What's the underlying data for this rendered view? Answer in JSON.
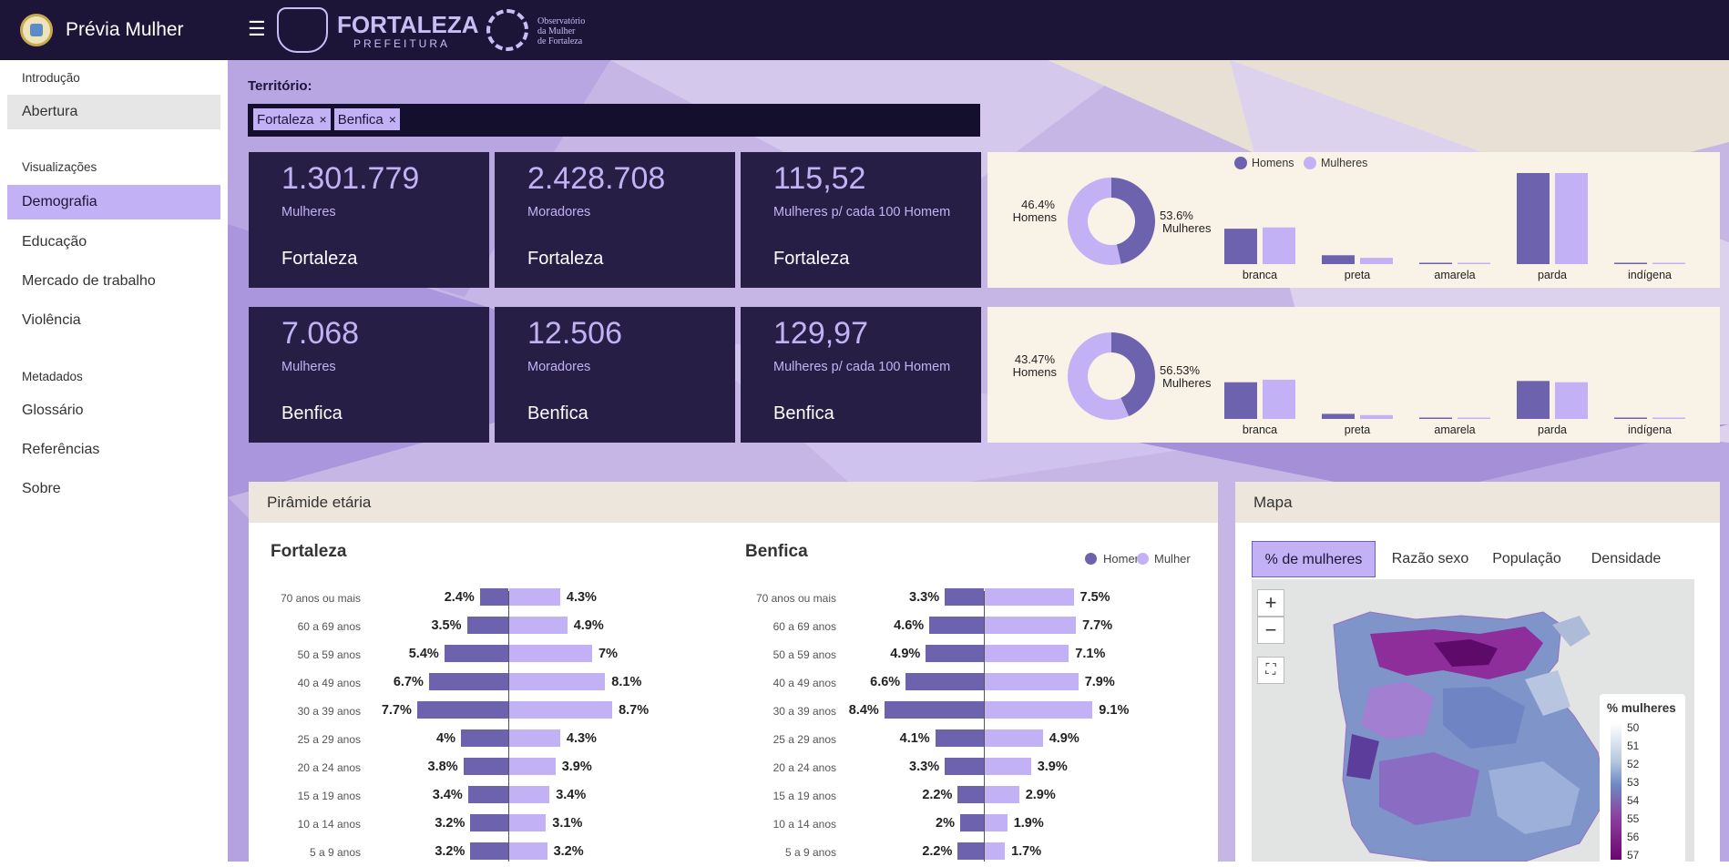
{
  "app": {
    "title": "Prévia Mulher"
  },
  "header": {
    "menu_icon": "hamburger-icon",
    "prefeitura_name": "FORTALEZA",
    "prefeitura_sub": "PREFEITURA",
    "observatorio_lines": [
      "Observatório",
      "da Mulher",
      "de Fortaleza"
    ]
  },
  "sidebar": {
    "sections": [
      {
        "title": "Introdução",
        "items": [
          {
            "label": "Abertura"
          }
        ]
      },
      {
        "title": "Visualizações",
        "items": [
          {
            "label": "Demografia"
          },
          {
            "label": "Educação"
          },
          {
            "label": "Mercado de trabalho"
          },
          {
            "label": "Violência"
          }
        ]
      },
      {
        "title": "Metadados",
        "items": [
          {
            "label": "Glossário"
          },
          {
            "label": "Referências"
          },
          {
            "label": "Sobre"
          }
        ]
      }
    ],
    "active": "Demografia"
  },
  "territorio": {
    "label": "Território:",
    "chips": [
      "Fortaleza",
      "Benfica"
    ],
    "remove_symbol": "×"
  },
  "stats": [
    [
      {
        "value": "1.301.779",
        "label": "Mulheres",
        "place": "Fortaleza"
      },
      {
        "value": "2.428.708",
        "label": "Moradores",
        "place": "Fortaleza"
      },
      {
        "value": "115,52",
        "label": "Mulheres p/ cada 100 Homem",
        "place": "Fortaleza"
      }
    ],
    [
      {
        "value": "7.068",
        "label": "Mulheres",
        "place": "Benfica"
      },
      {
        "value": "12.506",
        "label": "Moradores",
        "place": "Benfica"
      },
      {
        "value": "129,97",
        "label": "Mulheres p/ cada 100 Homem",
        "place": "Benfica"
      }
    ]
  ],
  "colors": {
    "homens": "#6c62ad",
    "mulheres": "#c2b2f5",
    "dark": "#1c1538",
    "card": "#261e45"
  },
  "chart_data": [
    {
      "type": "pie",
      "title": "",
      "labels": [
        "Homens",
        "Mulheres"
      ],
      "values": [
        46.4,
        53.6
      ],
      "value_labels": [
        "46.4%",
        "53.6%"
      ]
    },
    {
      "type": "bar",
      "title": "",
      "legend": [
        "Homens",
        "Mulheres"
      ],
      "legend_position": "top",
      "categories": [
        "branca",
        "preta",
        "amarela",
        "parda",
        "indígena"
      ],
      "series": [
        {
          "name": "Homens",
          "values": [
            28,
            7,
            0.3,
            72,
            0.2
          ]
        },
        {
          "name": "Mulheres",
          "values": [
            29,
            5,
            0.3,
            72,
            0.2
          ]
        }
      ]
    },
    {
      "type": "pie",
      "title": "",
      "labels": [
        "Homens",
        "Mulheres"
      ],
      "values": [
        43.47,
        56.53
      ],
      "value_labels": [
        "43.47%",
        "56.53%"
      ]
    },
    {
      "type": "bar",
      "title": "",
      "categories": [
        "branca",
        "preta",
        "amarela",
        "parda",
        "indígena"
      ],
      "series": [
        {
          "name": "Homens",
          "values": [
            29,
            4,
            0.5,
            30,
            0.2
          ]
        },
        {
          "name": "Mulheres",
          "values": [
            31,
            3,
            0.5,
            29,
            0.2
          ]
        }
      ]
    },
    {
      "type": "bar",
      "title": "Fortaleza",
      "orientation": "horizontal-pyramid",
      "categories": [
        "70 anos ou mais",
        "60 a 69 anos",
        "50 a 59 anos",
        "40 a 49 anos",
        "30 a 39 anos",
        "25 a 29 anos",
        "20 a 24 anos",
        "15 a 19 anos",
        "10 a 14 anos",
        "5 a 9 anos"
      ],
      "series": [
        {
          "name": "Homem",
          "values": [
            2.4,
            3.5,
            5.4,
            6.7,
            7.7,
            4,
            3.8,
            3.4,
            3.2,
            3.2
          ],
          "labels": [
            "2.4%",
            "3.5%",
            "5.4%",
            "6.7%",
            "7.7%",
            "4%",
            "3.8%",
            "3.4%",
            "3.2%",
            "3.2%"
          ]
        },
        {
          "name": "Mulher",
          "values": [
            4.3,
            4.9,
            7,
            8.1,
            8.7,
            4.3,
            3.9,
            3.4,
            3.1,
            3.2
          ],
          "labels": [
            "4.3%",
            "4.9%",
            "7%",
            "8.1%",
            "8.7%",
            "4.3%",
            "3.9%",
            "3.4%",
            "3.1%",
            "3.2%"
          ]
        }
      ]
    },
    {
      "type": "bar",
      "title": "Benfica",
      "orientation": "horizontal-pyramid",
      "legend": [
        "Homem",
        "Mulher"
      ],
      "legend_position": "top-right",
      "categories": [
        "70 anos ou mais",
        "60 a 69 anos",
        "50 a 59 anos",
        "40 a 49 anos",
        "30 a 39 anos",
        "25 a 29 anos",
        "20 a 24 anos",
        "15 a 19 anos",
        "10 a 14 anos",
        "5 a 9 anos"
      ],
      "series": [
        {
          "name": "Homem",
          "values": [
            3.3,
            4.6,
            4.9,
            6.6,
            8.4,
            4.1,
            3.3,
            2.2,
            2,
            2.2
          ],
          "labels": [
            "3.3%",
            "4.6%",
            "4.9%",
            "6.6%",
            "8.4%",
            "4.1%",
            "3.3%",
            "2.2%",
            "2%",
            "2.2%"
          ]
        },
        {
          "name": "Mulher",
          "values": [
            7.5,
            7.7,
            7.1,
            7.9,
            9.1,
            4.9,
            3.9,
            2.9,
            1.9,
            1.7
          ],
          "labels": [
            "7.5%",
            "7.7%",
            "7.1%",
            "7.9%",
            "9.1%",
            "4.9%",
            "3.9%",
            "2.9%",
            "1.9%",
            "1.7%"
          ]
        }
      ]
    }
  ],
  "cards": {
    "piramide_title": "Pirâmide etária",
    "mapa_title": "Mapa"
  },
  "map": {
    "tabs": [
      "% de mulheres",
      "Razão sexo",
      "População",
      "Densidade"
    ],
    "active_tab": "% de mulheres",
    "zoom_in": "+",
    "zoom_out": "−",
    "fullscreen_icon": "fullscreen-icon",
    "legend_title": "% mulheres",
    "legend_values": [
      "50",
      "51",
      "52",
      "53",
      "54",
      "55",
      "56",
      "57"
    ]
  }
}
